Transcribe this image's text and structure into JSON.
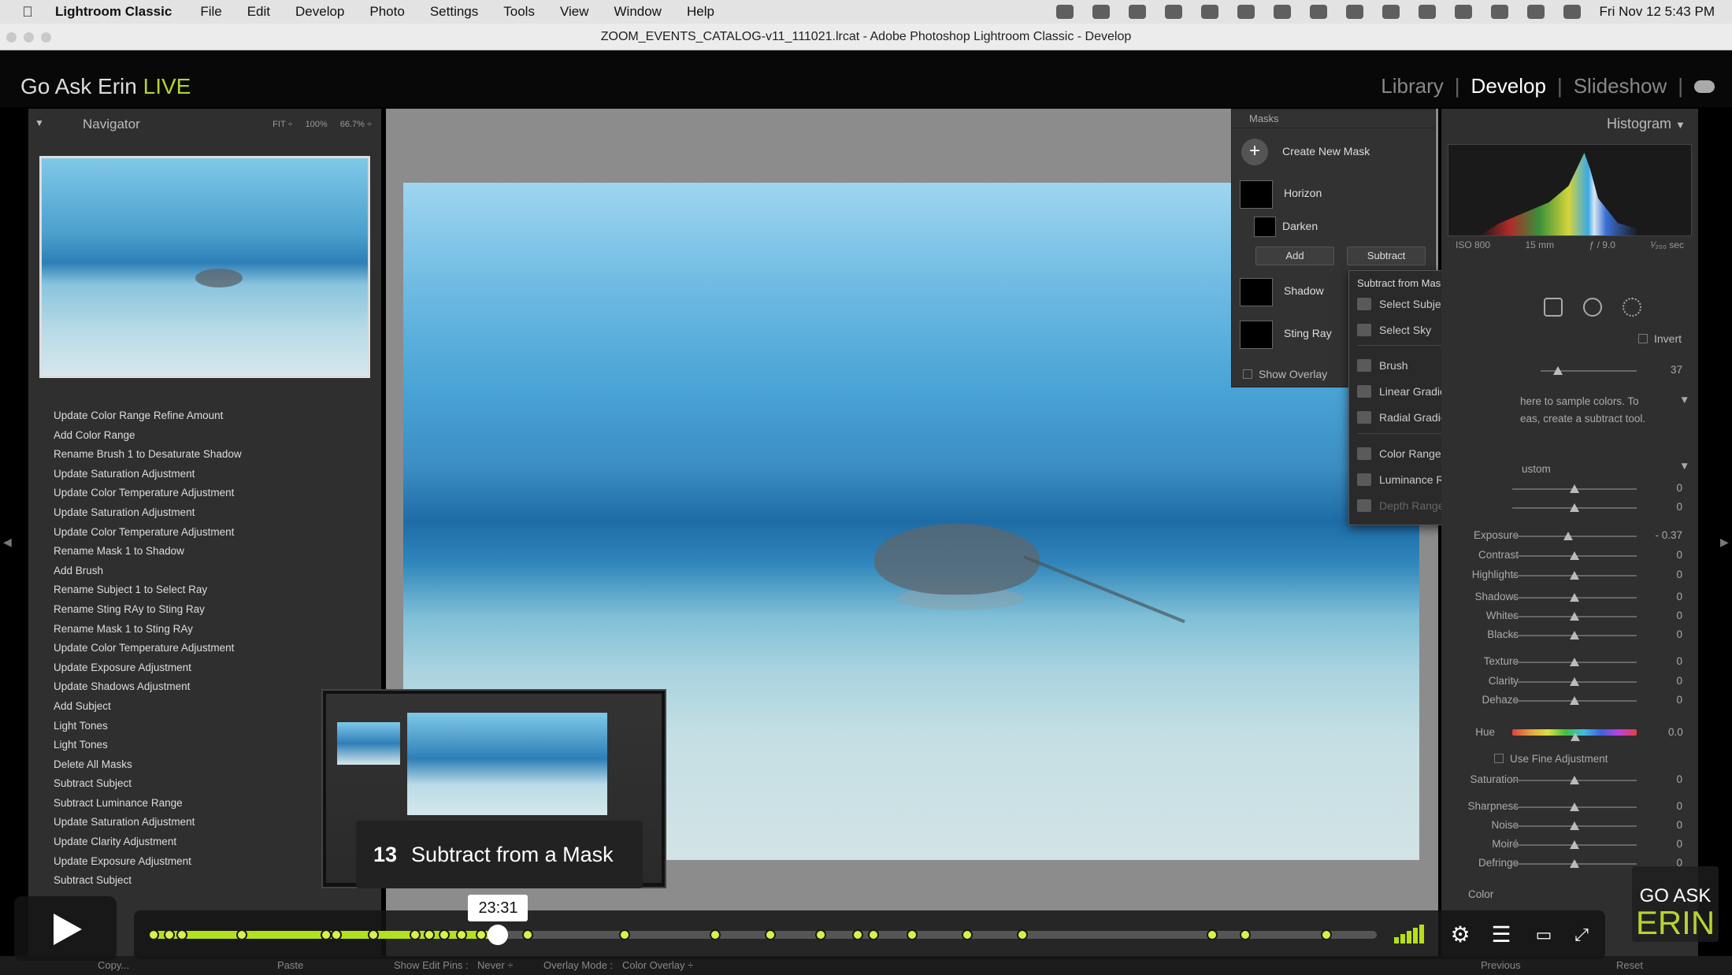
{
  "menubar": {
    "app": "Lightroom Classic",
    "items": [
      "File",
      "Edit",
      "Develop",
      "Photo",
      "Settings",
      "Tools",
      "View",
      "Window",
      "Help"
    ],
    "clock": "Fri Nov 12  5:43 PM"
  },
  "window": {
    "title": "ZOOM_EVENTS_CATALOG-v11_111021.lrcat - Adobe Photoshop Lightroom Classic - Develop"
  },
  "identity": {
    "brand_main": "Go Ask Erin ",
    "brand_accent": "LIVE"
  },
  "modules": {
    "library": "Library",
    "develop": "Develop",
    "slideshow": "Slideshow",
    "sep": "|"
  },
  "navigator": {
    "title": "Navigator",
    "zoom_fit": "FIT ÷",
    "zoom_100": "100%",
    "zoom_667": "66.7% ÷"
  },
  "history": [
    "Update Color Range Refine Amount",
    "Add Color Range",
    "Rename Brush 1 to Desaturate Shadow",
    "Update Saturation Adjustment",
    "Update Color Temperature Adjustment",
    "Update Saturation Adjustment",
    "Update Color Temperature Adjustment",
    "Rename Mask 1 to Shadow",
    "Add Brush",
    "Rename Subject 1 to Select Ray",
    "Rename Sting RAy to Sting Ray",
    "Rename Mask 1 to Sting RAy",
    "Update Color Temperature Adjustment",
    "Update Exposure Adjustment",
    "Update Shadows Adjustment",
    "Add Subject",
    "Light Tones",
    "Light Tones",
    "Delete All Masks",
    "Subtract Subject",
    "Subtract Luminance Range",
    "Update Saturation Adjustment",
    "Update Clarity Adjustment",
    "Update Exposure Adjustment",
    "Subtract Subject"
  ],
  "masks": {
    "title": "Masks",
    "create": "Create New Mask",
    "items": [
      {
        "name": "Horizon"
      },
      {
        "name": "Darken"
      },
      {
        "name": "Shadow"
      },
      {
        "name": "Sting Ray"
      }
    ],
    "add": "Add",
    "subtract": "Subtract",
    "show_overlay": "Show Overlay"
  },
  "dropdown": {
    "title": "Subtract from Mask with...",
    "items": [
      {
        "label": "Select Subject",
        "icon": "select-subject-icon",
        "enabled": true
      },
      {
        "label": "Select Sky",
        "icon": "select-sky-icon",
        "enabled": true
      },
      {
        "label": "Brush",
        "icon": "brush-icon",
        "enabled": true
      },
      {
        "label": "Linear Gradient",
        "icon": "linear-gradient-icon",
        "enabled": true
      },
      {
        "label": "Radial Gradient",
        "icon": "radial-gradient-icon",
        "enabled": true
      },
      {
        "label": "Color Range",
        "icon": "color-range-icon",
        "enabled": true
      },
      {
        "label": "Luminance Range",
        "icon": "luminance-range-icon",
        "enabled": true
      },
      {
        "label": "Depth Range",
        "icon": "depth-range-icon",
        "enabled": false
      }
    ]
  },
  "histogram": {
    "title": "Histogram",
    "iso": "ISO 800",
    "focal": "15 mm",
    "aperture": "ƒ / 9.0",
    "shutter": "¹⁄₂₀₀ sec"
  },
  "develop": {
    "invert": "Invert",
    "amount_value": "37",
    "hint_line1": "here to sample colors. To",
    "hint_line2": "eas, create a subtract tool.",
    "preset_label": "ustom",
    "sliders": [
      {
        "label": "",
        "value": "0",
        "pos": 0.5
      },
      {
        "label": "",
        "value": "0",
        "pos": 0.5
      },
      {
        "label": "Exposure",
        "value": "- 0.37",
        "pos": 0.45
      },
      {
        "label": "Contrast",
        "value": "0",
        "pos": 0.5
      },
      {
        "label": "Highlights",
        "value": "0",
        "pos": 0.5
      },
      {
        "label": "Shadows",
        "value": "0",
        "pos": 0.5
      },
      {
        "label": "Whites",
        "value": "0",
        "pos": 0.5
      },
      {
        "label": "Blacks",
        "value": "0",
        "pos": 0.5
      },
      {
        "label": "Texture",
        "value": "0",
        "pos": 0.5
      },
      {
        "label": "Clarity",
        "value": "0",
        "pos": 0.5
      },
      {
        "label": "Dehaze",
        "value": "0",
        "pos": 0.5
      }
    ],
    "hue_label": "Hue",
    "hue_value": "0.0",
    "fine_adjust": "Use Fine Adjustment",
    "lower_sliders": [
      {
        "label": "Saturation",
        "value": "0",
        "pos": 0.5
      },
      {
        "label": "Sharpness",
        "value": "0",
        "pos": 0.5
      },
      {
        "label": "Noise",
        "value": "0",
        "pos": 0.5
      },
      {
        "label": "Moiré",
        "value": "0",
        "pos": 0.5
      },
      {
        "label": "Defringe",
        "value": "0",
        "pos": 0.5
      }
    ],
    "color_label": "Color"
  },
  "video": {
    "chapter_number": "13",
    "chapter_title": "Subtract from a Mask",
    "time": "23:31",
    "progress": 0.284,
    "chapters": [
      0.003,
      0.016,
      0.026,
      0.075,
      0.144,
      0.152,
      0.182,
      0.216,
      0.228,
      0.24,
      0.254,
      0.27,
      0.286,
      0.308,
      0.387,
      0.461,
      0.506,
      0.547,
      0.577,
      0.59,
      0.621,
      0.666,
      0.711,
      0.866,
      0.893,
      0.959
    ],
    "watermark_top": "GO ASK",
    "watermark_bottom": "ERIN"
  },
  "bottom": {
    "copy": "Copy...",
    "paste": "Paste",
    "show_edit_pins": "Show Edit Pins :",
    "edit_pins_value": "Never ÷",
    "overlay_mode": "Overlay Mode :",
    "overlay_value": "Color Overlay ÷",
    "previous": "Previous",
    "reset": "Reset"
  }
}
